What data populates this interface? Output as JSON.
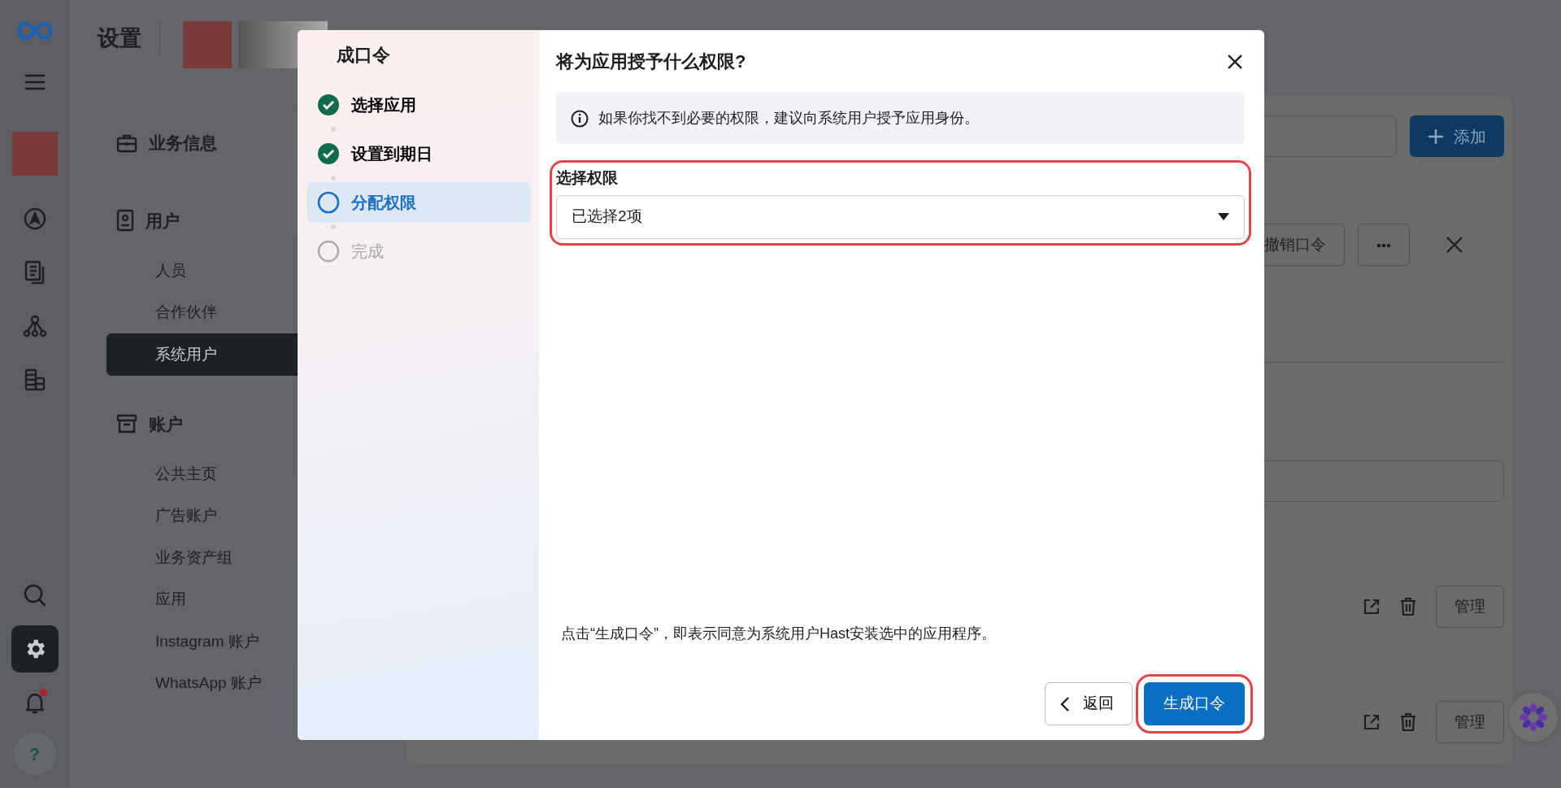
{
  "page_title": "设置",
  "rail": {
    "items": [
      {
        "kind": "menu",
        "selected": false
      },
      {
        "kind": "compass",
        "selected": false
      },
      {
        "kind": "docs",
        "selected": false
      },
      {
        "kind": "network",
        "selected": false
      },
      {
        "kind": "coins",
        "selected": false
      }
    ],
    "bottom": [
      {
        "kind": "search",
        "selected": false
      },
      {
        "kind": "settings",
        "selected": true
      },
      {
        "kind": "bell",
        "selected": false,
        "notification": true
      }
    ],
    "help": "?"
  },
  "nav": {
    "sections": [
      {
        "title": "业务信息",
        "kind": "briefcase"
      },
      {
        "title": "用户",
        "kind": "badge",
        "items": [
          {
            "label": "人员",
            "selected": false
          },
          {
            "label": "合作伙伴",
            "selected": false
          },
          {
            "label": "系统用户",
            "selected": true
          }
        ]
      },
      {
        "title": "账户",
        "kind": "archive",
        "items": [
          {
            "label": "公共主页",
            "selected": false
          },
          {
            "label": "广告账户",
            "selected": false
          },
          {
            "label": "业务资产组",
            "selected": false
          },
          {
            "label": "应用",
            "selected": false
          },
          {
            "label": "Instagram 账户",
            "selected": false
          },
          {
            "label": "WhatsApp 账户",
            "selected": false
          }
        ]
      }
    ]
  },
  "main": {
    "add_button": "添加",
    "revoke_button": "撤销口令",
    "rows": [
      {
        "manage": "管理"
      },
      {
        "manage": "管理"
      }
    ]
  },
  "dialog": {
    "title": "成口令",
    "steps": [
      {
        "label": "选择应用",
        "kind": "done",
        "selected": false
      },
      {
        "label": "设置到期日",
        "kind": "done",
        "selected": false
      },
      {
        "label": "分配权限",
        "kind": "current",
        "selected": true
      },
      {
        "label": "完成",
        "kind": "todo",
        "selected": false
      }
    ],
    "heading": "将为应用授予什么权限?",
    "info": "如果你找不到必要的权限，建议向系统用户授予应用身份。",
    "field": {
      "label": "选择权限",
      "value": "已选择2项",
      "highlighted": true
    },
    "consent": "点击“生成口令”，即表示同意为系统用户Hast安装选中的应用程序。",
    "buttons": [
      {
        "label": "返回",
        "kind": "back",
        "highlighted": false
      },
      {
        "label": "生成口令",
        "kind": "primary",
        "highlighted": true
      }
    ]
  }
}
